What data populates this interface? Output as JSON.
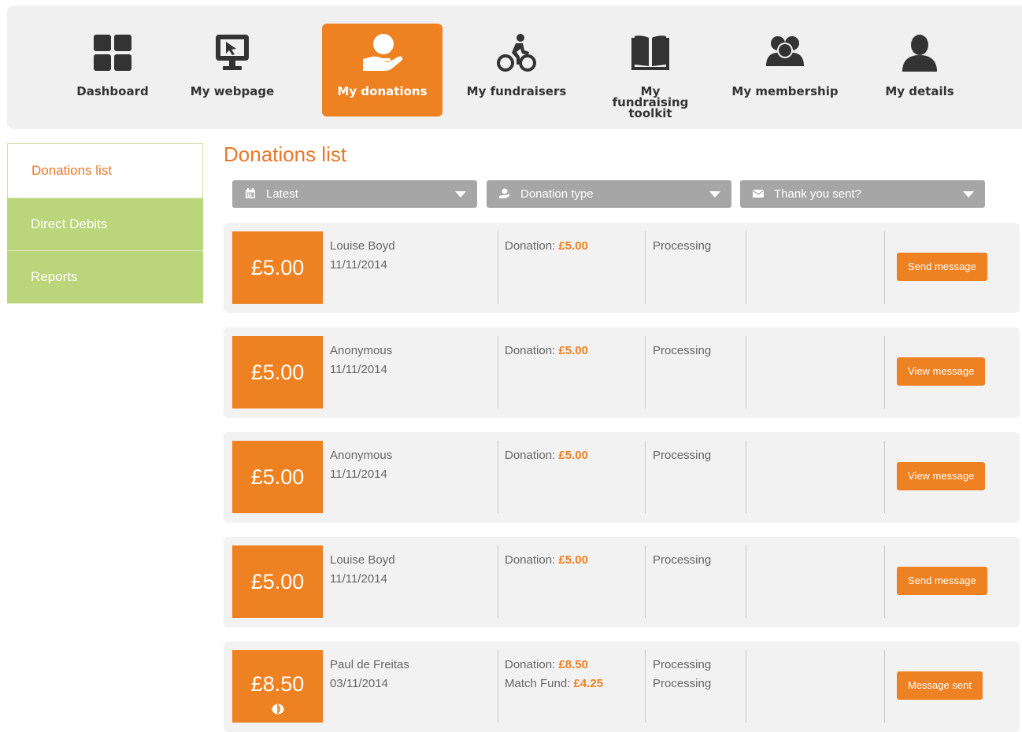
{
  "nav": {
    "items": [
      {
        "label": "Dashboard",
        "icon": "dashboard-icon"
      },
      {
        "label": "My webpage",
        "icon": "monitor-cursor-icon"
      },
      {
        "label": "My donations",
        "icon": "donation-hand-icon",
        "active": true
      },
      {
        "label": "My fundraisers",
        "icon": "cyclist-icon"
      },
      {
        "label": "My fundraising toolkit",
        "icon": "book-icon"
      },
      {
        "label": "My membership",
        "icon": "group-icon"
      },
      {
        "label": "My details",
        "icon": "user-icon"
      }
    ]
  },
  "sidebar": {
    "items": [
      {
        "label": "Donations list",
        "active": true
      },
      {
        "label": "Direct Debits"
      },
      {
        "label": "Reports"
      }
    ]
  },
  "page_title": "Donations list",
  "filters": [
    {
      "label": "Latest",
      "icon": "calendar-icon"
    },
    {
      "label": "Donation type",
      "icon": "donation-type-icon"
    },
    {
      "label": "Thank you sent?",
      "icon": "envelope-icon"
    }
  ],
  "donations": [
    {
      "amount": "£5.00",
      "name": "Louise Boyd",
      "date": "11/11/2014",
      "donation_label": "Donation: ",
      "donation_value": "£5.00",
      "status": "Processing",
      "action": "Send message"
    },
    {
      "amount": "£5.00",
      "name": "Anonymous",
      "date": "11/11/2014",
      "donation_label": "Donation: ",
      "donation_value": "£5.00",
      "status": "Processing",
      "action": "View message"
    },
    {
      "amount": "£5.00",
      "name": "Anonymous",
      "date": "11/11/2014",
      "donation_label": "Donation: ",
      "donation_value": "£5.00",
      "status": "Processing",
      "action": "View message"
    },
    {
      "amount": "£5.00",
      "name": "Louise Boyd",
      "date": "11/11/2014",
      "donation_label": "Donation: ",
      "donation_value": "£5.00",
      "status": "Processing",
      "action": "Send message"
    },
    {
      "amount": "£8.50",
      "name": "Paul de Freitas",
      "date": "03/11/2014",
      "donation_label": "Donation: ",
      "donation_value": "£8.50",
      "match_label": "Match Fund: ",
      "match_value": "£4.25",
      "status": "Processing",
      "match_status": "Processing",
      "action": "Message sent",
      "match_icon": "match-fund-icon"
    }
  ],
  "colors": {
    "accent": "#ee8122",
    "sidebar_green": "#bbd57a",
    "filter_grey": "#a6a6a6",
    "row_bg": "#f2f2f2",
    "title_orange": "#e9772a"
  }
}
